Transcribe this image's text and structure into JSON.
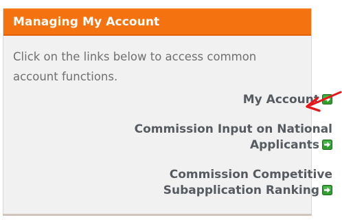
{
  "panel": {
    "title": "Managing My Account",
    "intro_text": "Click on the links below to access common account functions."
  },
  "links": [
    {
      "lines": [
        "My Account"
      ],
      "icon": "green-arrow-right-icon"
    },
    {
      "lines": [
        "Commission Input on National",
        "Applicants"
      ],
      "icon": "green-arrow-right-icon"
    },
    {
      "lines": [
        "Commission Competitive",
        "Subapplication Ranking"
      ],
      "icon": "green-arrow-right-icon"
    }
  ],
  "annotation": {
    "icon": "red-pointer-arrow",
    "color": "#e8161b"
  },
  "colors": {
    "header_bg": "#f4720f",
    "panel_bg": "#f1f1f1",
    "link_text": "#555b60",
    "icon_green": "#2f9e2f"
  }
}
